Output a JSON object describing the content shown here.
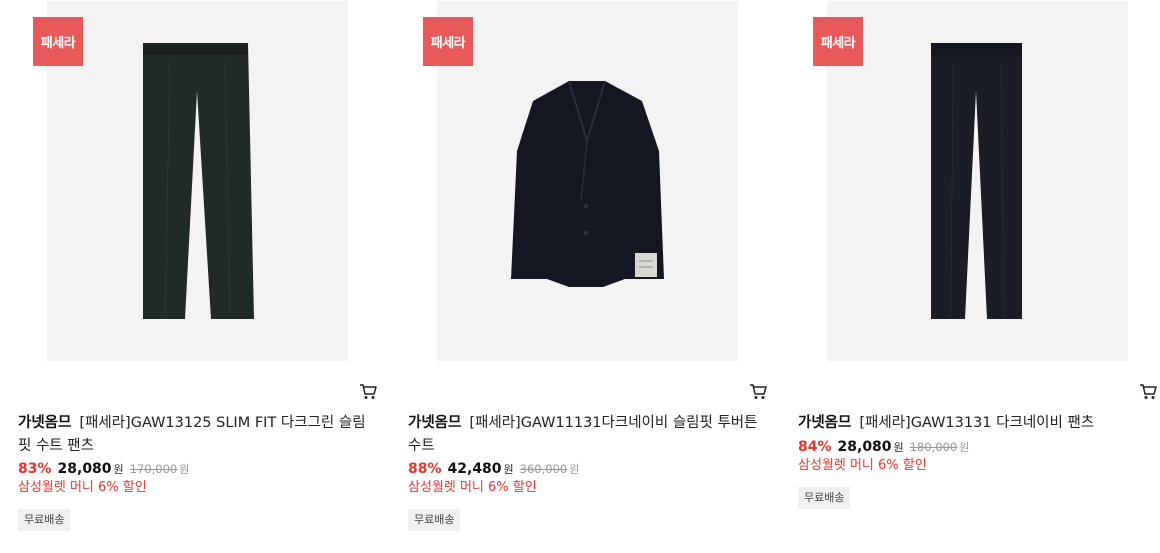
{
  "products": [
    {
      "badge": "패세라",
      "brand": "가넷옴므",
      "name": "[패세라]GAW13125 SLIM FIT 다크그린 슬림핏 수트 팬츠",
      "discount": "83%",
      "price": "28,080",
      "price_unit": "원",
      "original_price": "170,000",
      "original_unit": "원",
      "promo": "삼성월렛 머니 6% 할인",
      "shipping": "무료배송",
      "image_type": "pants",
      "garment_color": "#222a25"
    },
    {
      "badge": "패세라",
      "brand": "가넷옴므",
      "name": "[패세라]GAW11131다크네이비 슬림핏 투버튼 수트",
      "discount": "88%",
      "price": "42,480",
      "price_unit": "원",
      "original_price": "360,000",
      "original_unit": "원",
      "promo": "삼성월렛 머니 6% 할인",
      "shipping": "무료배송",
      "image_type": "jacket",
      "garment_color": "#141722"
    },
    {
      "badge": "패세라",
      "brand": "가넷옴므",
      "name": "[패세라]GAW13131 다크네이비 팬츠",
      "discount": "84%",
      "price": "28,080",
      "price_unit": "원",
      "original_price": "180,000",
      "original_unit": "원",
      "promo": "삼성월렛 머니 6% 할인",
      "shipping": "무료배송",
      "image_type": "pants",
      "garment_color": "#1a1c26"
    }
  ],
  "icons": {
    "cart": "cart-icon"
  },
  "colors": {
    "badge": "#e85a5a",
    "discount": "#e8352e",
    "image_bg": "#f3f3f3"
  }
}
